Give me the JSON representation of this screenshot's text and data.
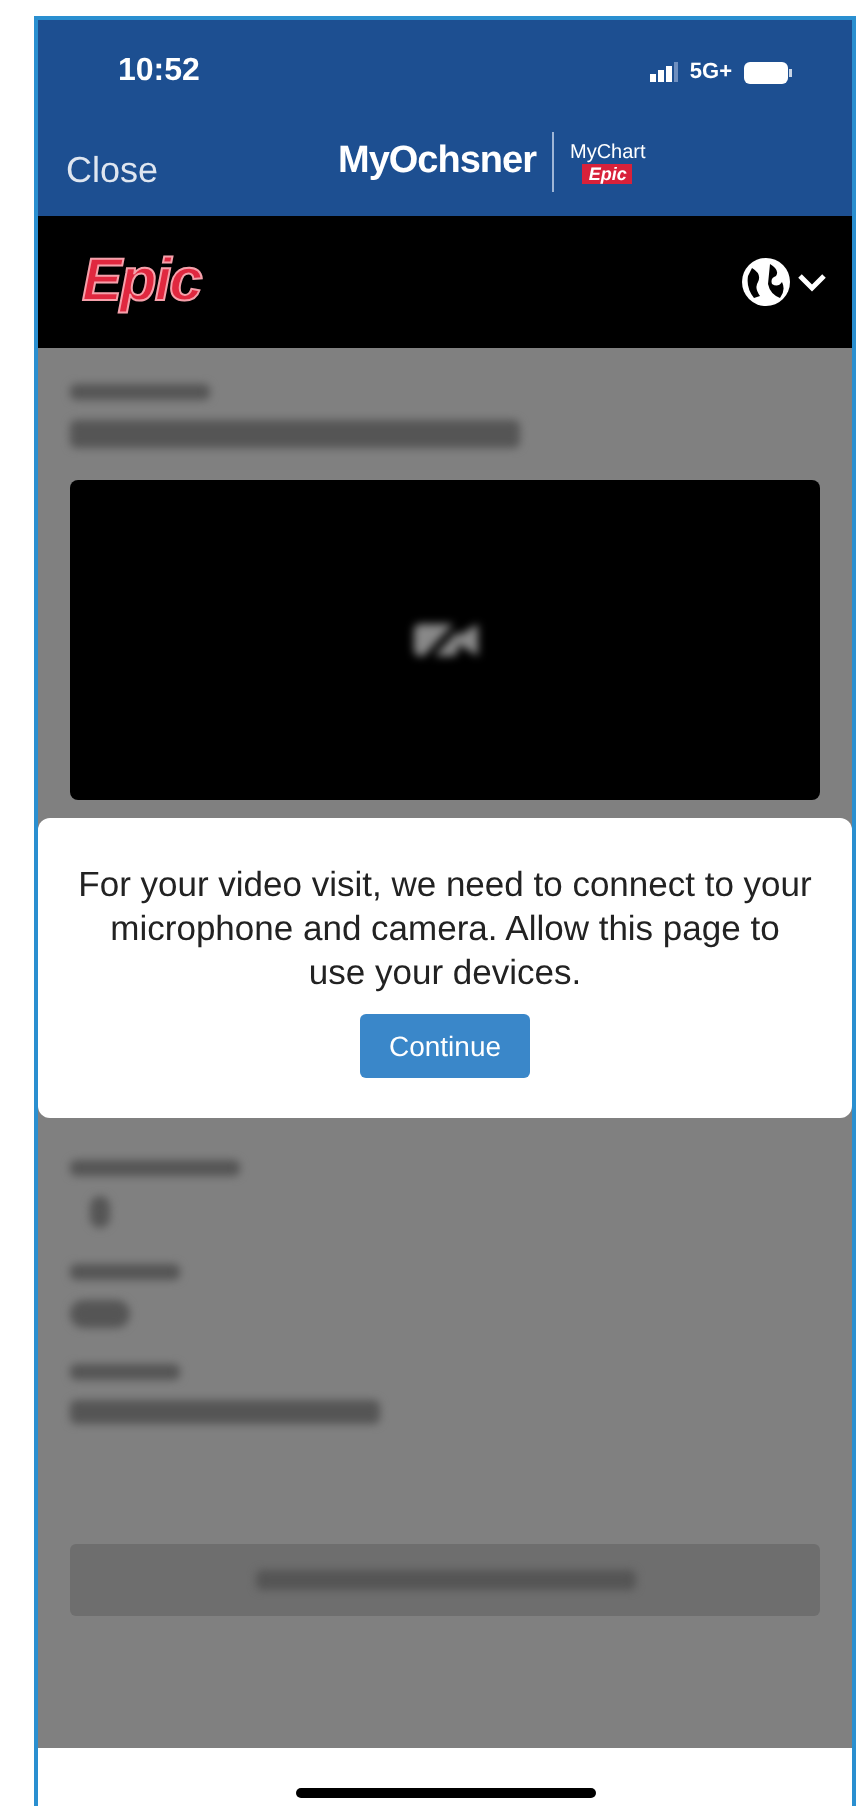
{
  "status_bar": {
    "time": "10:52",
    "network": "5G+"
  },
  "header": {
    "close_label": "Close",
    "brand": "MyOchsner",
    "partner_top": "MyChart",
    "partner_bottom": "Epic"
  },
  "epic_bar": {
    "logo": "Epic"
  },
  "dialog": {
    "message": "For your video visit, we need to connect to your microphone and camera. Allow this page to use your devices.",
    "button": "Continue"
  }
}
